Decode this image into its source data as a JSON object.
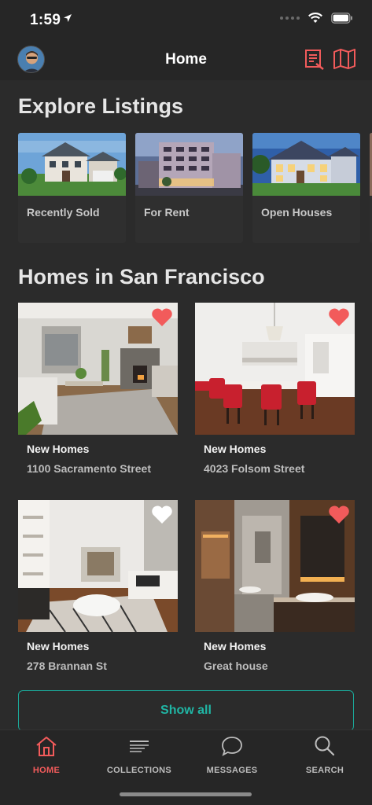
{
  "status": {
    "time": "1:59"
  },
  "header": {
    "title": "Home"
  },
  "explore": {
    "title": "Explore Listings",
    "cards": [
      {
        "label": "Recently Sold"
      },
      {
        "label": "For Rent"
      },
      {
        "label": "Open Houses"
      }
    ]
  },
  "homes": {
    "title": "Homes in San Francisco",
    "items": [
      {
        "type": "New Homes",
        "address": "1100 Sacramento Street",
        "favorited": true
      },
      {
        "type": "New Homes",
        "address": "4023 Folsom Street",
        "favorited": true
      },
      {
        "type": "New Homes",
        "address": "278 Brannan St",
        "favorited": false
      },
      {
        "type": "New Homes",
        "address": "Great house",
        "favorited": true
      }
    ],
    "show_all_label": "Show all"
  },
  "tabs": [
    {
      "label": "HOME",
      "icon": "home-icon",
      "active": true
    },
    {
      "label": "COLLECTIONS",
      "icon": "collections-icon",
      "active": false
    },
    {
      "label": "MESSAGES",
      "icon": "messages-icon",
      "active": false
    },
    {
      "label": "SEARCH",
      "icon": "search-icon",
      "active": false
    }
  ],
  "colors": {
    "accent": "#f25b5b",
    "teal": "#20b6a5",
    "background": "#262626"
  }
}
